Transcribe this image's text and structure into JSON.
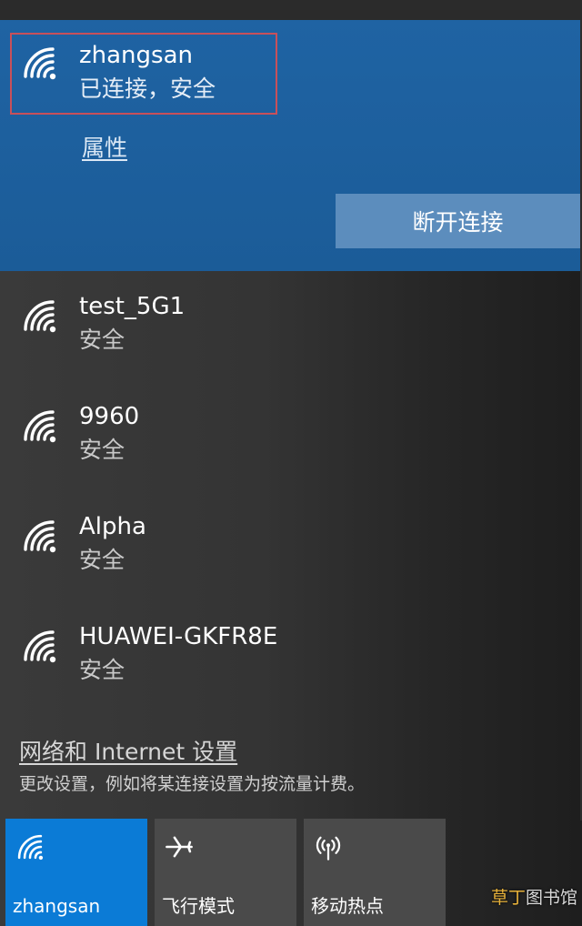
{
  "connected_network": {
    "name": "zhangsan",
    "status": "已连接，安全",
    "properties_link": "属性",
    "disconnect_button": "断开连接"
  },
  "networks": [
    {
      "name": "test_5G1",
      "status": "安全"
    },
    {
      "name": "9960",
      "status": "安全"
    },
    {
      "name": "Alpha",
      "status": "安全"
    },
    {
      "name": "HUAWEI-GKFR8E",
      "status": "安全"
    }
  ],
  "settings": {
    "link_text": "网络和 Internet 设置",
    "description": "更改设置，例如将某连接设置为按流量计费。"
  },
  "quick_actions": [
    {
      "label": "zhangsan",
      "icon": "wifi-icon",
      "active": true
    },
    {
      "label": "飞行模式",
      "icon": "airplane-icon",
      "active": false
    },
    {
      "label": "移动热点",
      "icon": "hotspot-icon",
      "active": false
    }
  ],
  "watermark": {
    "highlight": "草丁",
    "rest": "图书馆"
  },
  "colors": {
    "connected_bg": "#1f63a3",
    "disconnect_button": "#5c8dbd",
    "active_tile": "#0b7bd6",
    "tile": "#4a4a4a",
    "highlight_border": "#c8505a"
  }
}
